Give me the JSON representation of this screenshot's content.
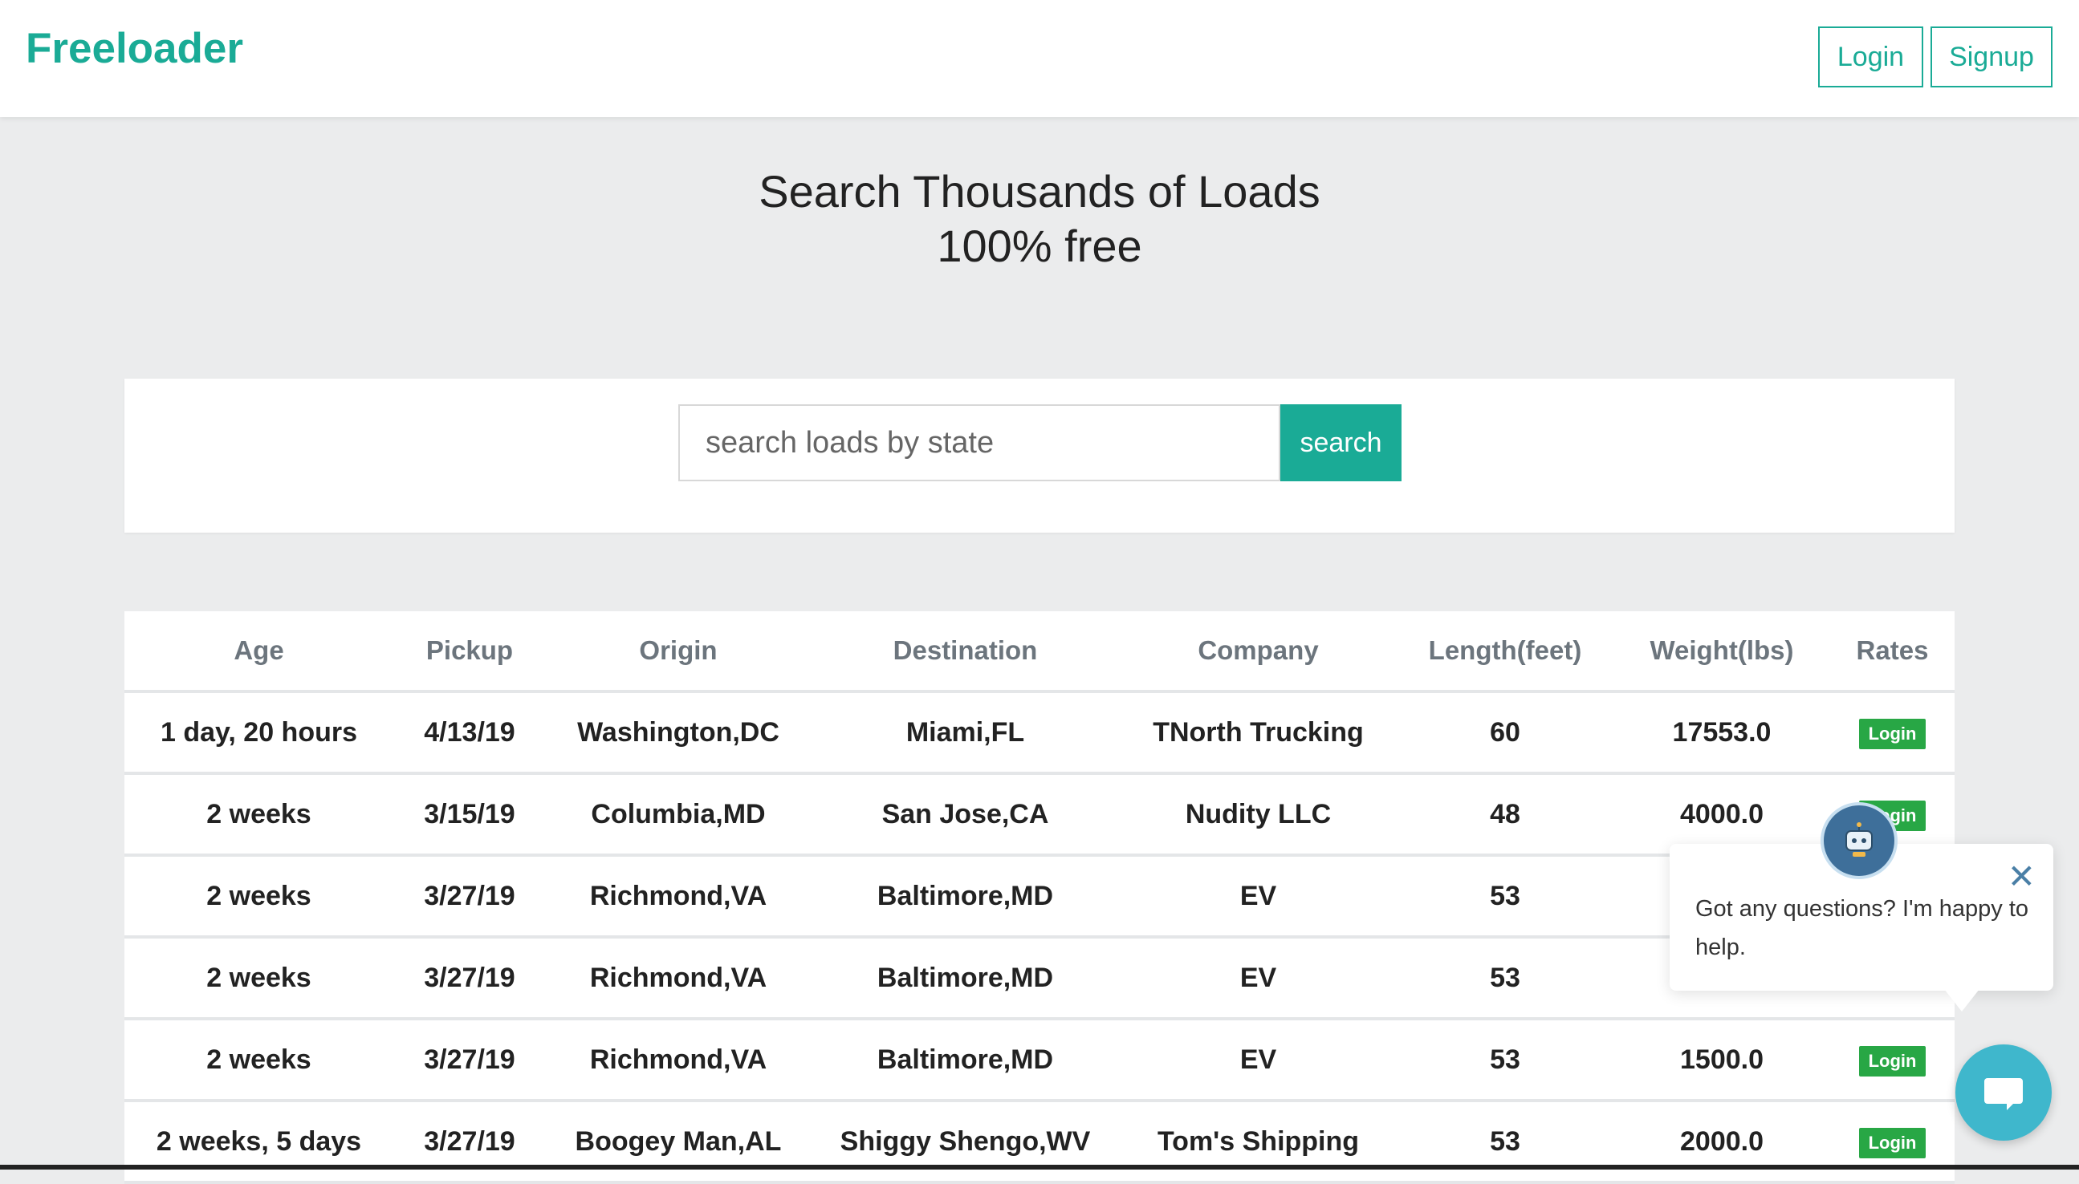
{
  "brand": "Freeloader",
  "nav": {
    "login": "Login",
    "signup": "Signup"
  },
  "hero": {
    "line1": "Search Thousands of Loads",
    "line2": "100% free"
  },
  "search": {
    "placeholder": "search loads by state",
    "button": "search"
  },
  "table": {
    "headers": [
      "Age",
      "Pickup",
      "Origin",
      "Destination",
      "Company",
      "Length(feet)",
      "Weight(lbs)",
      "Rates"
    ],
    "rows": [
      [
        "1 day, 20 hours",
        "4/13/19",
        "Washington,DC",
        "Miami,FL",
        "TNorth Trucking",
        "60",
        "17553.0",
        "Login"
      ],
      [
        "2 weeks",
        "3/15/19",
        "Columbia,MD",
        "San Jose,CA",
        "Nudity LLC",
        "48",
        "4000.0",
        "Login"
      ],
      [
        "2 weeks",
        "3/27/19",
        "Richmond,VA",
        "Baltimore,MD",
        "EV",
        "53",
        "",
        ""
      ],
      [
        "2 weeks",
        "3/27/19",
        "Richmond,VA",
        "Baltimore,MD",
        "EV",
        "53",
        "",
        ""
      ],
      [
        "2 weeks",
        "3/27/19",
        "Richmond,VA",
        "Baltimore,MD",
        "EV",
        "53",
        "1500.0",
        "Login"
      ],
      [
        "2 weeks, 5 days",
        "3/27/19",
        "Boogey Man,AL",
        "Shiggy Shengo,WV",
        "Tom's Shipping",
        "53",
        "2000.0",
        "Login"
      ]
    ]
  },
  "chat": {
    "message": "Got any questions? I'm happy to help.",
    "close_icon": "close-icon",
    "avatar_icon": "robot-avatar-icon",
    "launcher_icon": "chat-bubble-icon"
  },
  "colors": {
    "brand": "#1aab96",
    "rate_button": "#28a745",
    "chat": "#3fb7cc"
  }
}
